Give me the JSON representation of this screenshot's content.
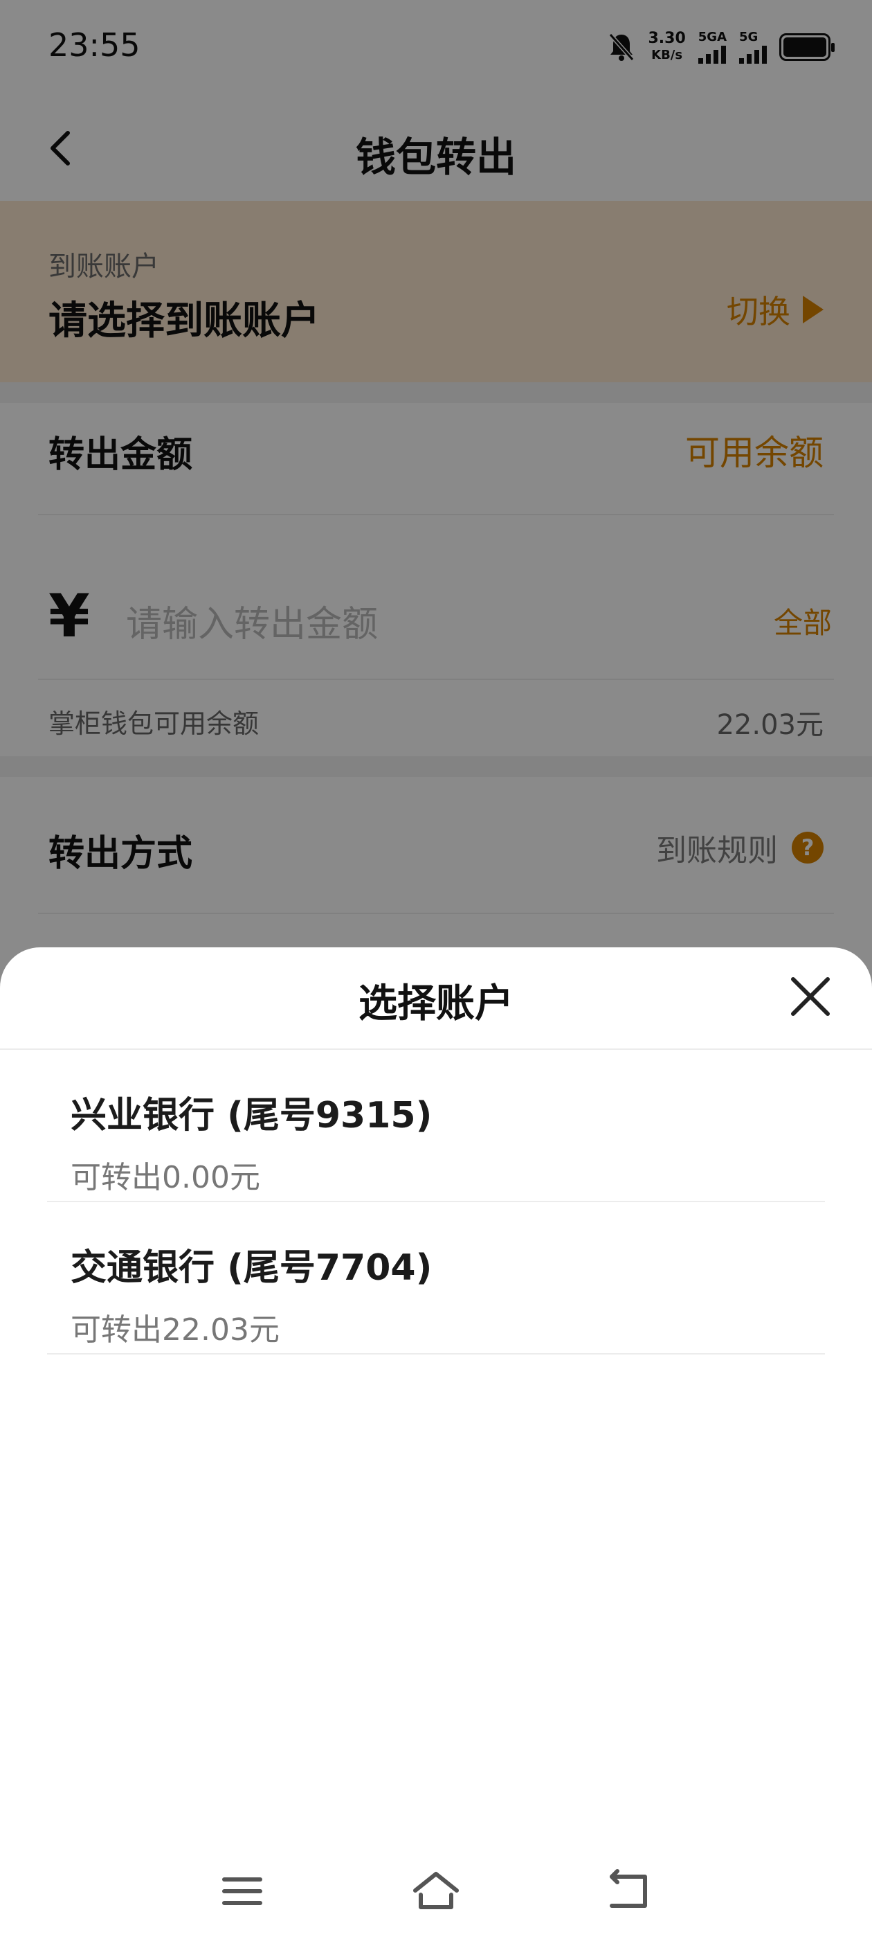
{
  "status_bar": {
    "time": "23:55",
    "net_speed_value": "3.30",
    "net_speed_unit": "KB/s",
    "sim1_label": "5GA",
    "sim2_label": "5G"
  },
  "header": {
    "title": "钱包转出"
  },
  "account": {
    "label": "到账账户",
    "placeholder_text": "请选择到账账户",
    "switch_label": "切换"
  },
  "amount": {
    "title": "转出金额",
    "available_link": "可用余额",
    "currency_symbol": "¥",
    "input_placeholder": "请输入转出金额",
    "input_value": "",
    "all_label": "全部",
    "balance_label": "掌柜钱包可用余额",
    "balance_value": "22.03元"
  },
  "method": {
    "title": "转出方式",
    "rules_label": "到账规则",
    "help_symbol": "?"
  },
  "sheet": {
    "title": "选择账户",
    "accounts": [
      {
        "name": "兴业银行 (尾号9315)",
        "available": "可转出0.00元"
      },
      {
        "name": "交通银行 (尾号7704)",
        "available": "可转出22.03元"
      }
    ]
  },
  "colors": {
    "accent": "#d68200",
    "account_band_bg": "#fbe7cf",
    "overlay": "rgba(0,0,0,0.46)"
  },
  "icons": {
    "back": "chevron-left-icon",
    "switch": "triangle-right-icon",
    "help": "question-circle-icon",
    "close": "close-icon",
    "nav_menu": "menu-icon",
    "nav_home": "home-icon",
    "nav_back": "back-icon"
  }
}
